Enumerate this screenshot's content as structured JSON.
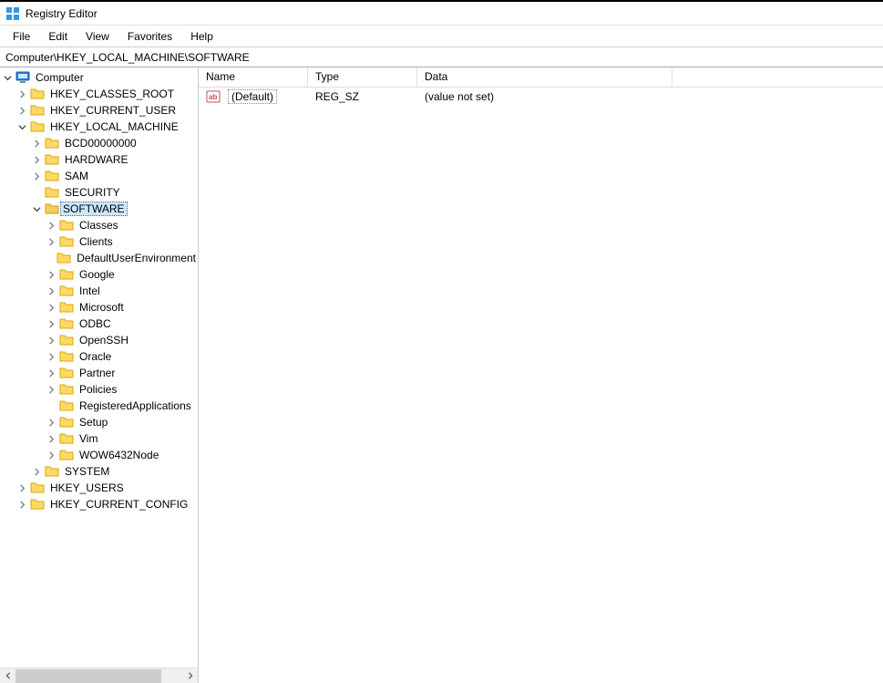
{
  "title": "Registry Editor",
  "menu": {
    "file": "File",
    "edit": "Edit",
    "view": "View",
    "favorites": "Favorites",
    "help": "Help"
  },
  "address": "Computer\\HKEY_LOCAL_MACHINE\\SOFTWARE",
  "tree": {
    "root": "Computer",
    "hkcr": "HKEY_CLASSES_ROOT",
    "hkcu": "HKEY_CURRENT_USER",
    "hklm": "HKEY_LOCAL_MACHINE",
    "bcd": "BCD00000000",
    "hardware": "HARDWARE",
    "sam": "SAM",
    "security": "SECURITY",
    "software": "SOFTWARE",
    "classes": "Classes",
    "clients": "Clients",
    "due": "DefaultUserEnvironment",
    "google": "Google",
    "intel": "Intel",
    "microsoft": "Microsoft",
    "odbc": "ODBC",
    "openssh": "OpenSSH",
    "oracle": "Oracle",
    "partner": "Partner",
    "policies": "Policies",
    "regapps": "RegisteredApplications",
    "setup": "Setup",
    "vim": "Vim",
    "wow64": "WOW6432Node",
    "system": "SYSTEM",
    "hku": "HKEY_USERS",
    "hkcc": "HKEY_CURRENT_CONFIG"
  },
  "list": {
    "headers": {
      "name": "Name",
      "type": "Type",
      "data": "Data"
    },
    "rows": [
      {
        "name": "(Default)",
        "type": "REG_SZ",
        "data": "(value not set)"
      }
    ]
  }
}
